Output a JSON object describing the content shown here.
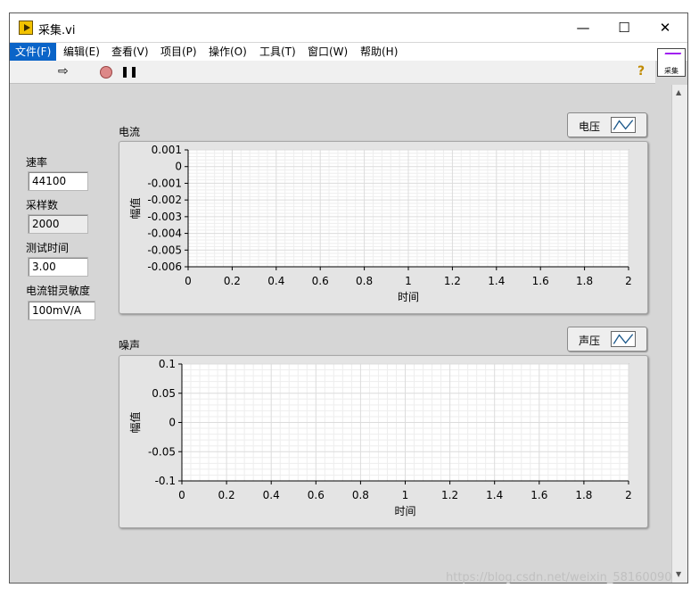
{
  "window": {
    "title": "采集.vi"
  },
  "window_controls": {
    "minimize": "—",
    "maximize": "☐",
    "close": "✕"
  },
  "menu": [
    {
      "label": "文件(F)",
      "active": true
    },
    {
      "label": "编辑(E)",
      "active": false
    },
    {
      "label": "查看(V)",
      "active": false
    },
    {
      "label": "项目(P)",
      "active": false
    },
    {
      "label": "操作(O)",
      "active": false
    },
    {
      "label": "工具(T)",
      "active": false
    },
    {
      "label": "窗口(W)",
      "active": false
    },
    {
      "label": "帮助(H)",
      "active": false
    }
  ],
  "toolbar": {
    "run_icon": "run-arrow-icon",
    "abort_icon": "abort-icon",
    "pause_icon": "pause-icon",
    "help_icon": "help-icon",
    "help_glyph": "?",
    "pause_glyph": "❚❚",
    "run_glyph": "⇨"
  },
  "vi_icon": {
    "label": "采集"
  },
  "controls": {
    "rate": {
      "label": "速率",
      "value": "44100"
    },
    "samples": {
      "label": "采样数",
      "value": "2000"
    },
    "test_time": {
      "label": "测试时间",
      "value": "3.00"
    },
    "clamp_sensitivity": {
      "label": "电流钳灵敏度",
      "value": "100mV/A"
    }
  },
  "chart_data": [
    {
      "type": "line",
      "title": "电流",
      "legend": [
        "电压"
      ],
      "xlabel": "时间",
      "ylabel": "幅值",
      "xlim": [
        0,
        2
      ],
      "ylim": [
        -0.006,
        0.001
      ],
      "xticks": [
        "0",
        "0.2",
        "0.4",
        "0.6",
        "0.8",
        "1",
        "1.2",
        "1.4",
        "1.6",
        "1.8",
        "2"
      ],
      "yticks": [
        "0.001",
        "0",
        "-0.001",
        "-0.002",
        "-0.003",
        "-0.004",
        "-0.005",
        "-0.006"
      ],
      "grid": true,
      "series": []
    },
    {
      "type": "line",
      "title": "噪声",
      "legend": [
        "声压"
      ],
      "xlabel": "时间",
      "ylabel": "幅值",
      "xlim": [
        0,
        2
      ],
      "ylim": [
        -0.1,
        0.1
      ],
      "xticks": [
        "0",
        "0.2",
        "0.4",
        "0.6",
        "0.8",
        "1",
        "1.2",
        "1.4",
        "1.6",
        "1.8",
        "2"
      ],
      "yticks": [
        "0.1",
        "0.05",
        "0",
        "-0.05",
        "-0.1"
      ],
      "grid": true,
      "series": []
    }
  ],
  "watermark": "https://blog.csdn.net/weixin_58160090",
  "colors": {
    "menu_active": "#0a64c8",
    "panel_bg": "#d6d6d6",
    "plot_bg": "#ffffff",
    "grid_major": "#dcdcdc",
    "grid_minor": "#eeeeee"
  }
}
